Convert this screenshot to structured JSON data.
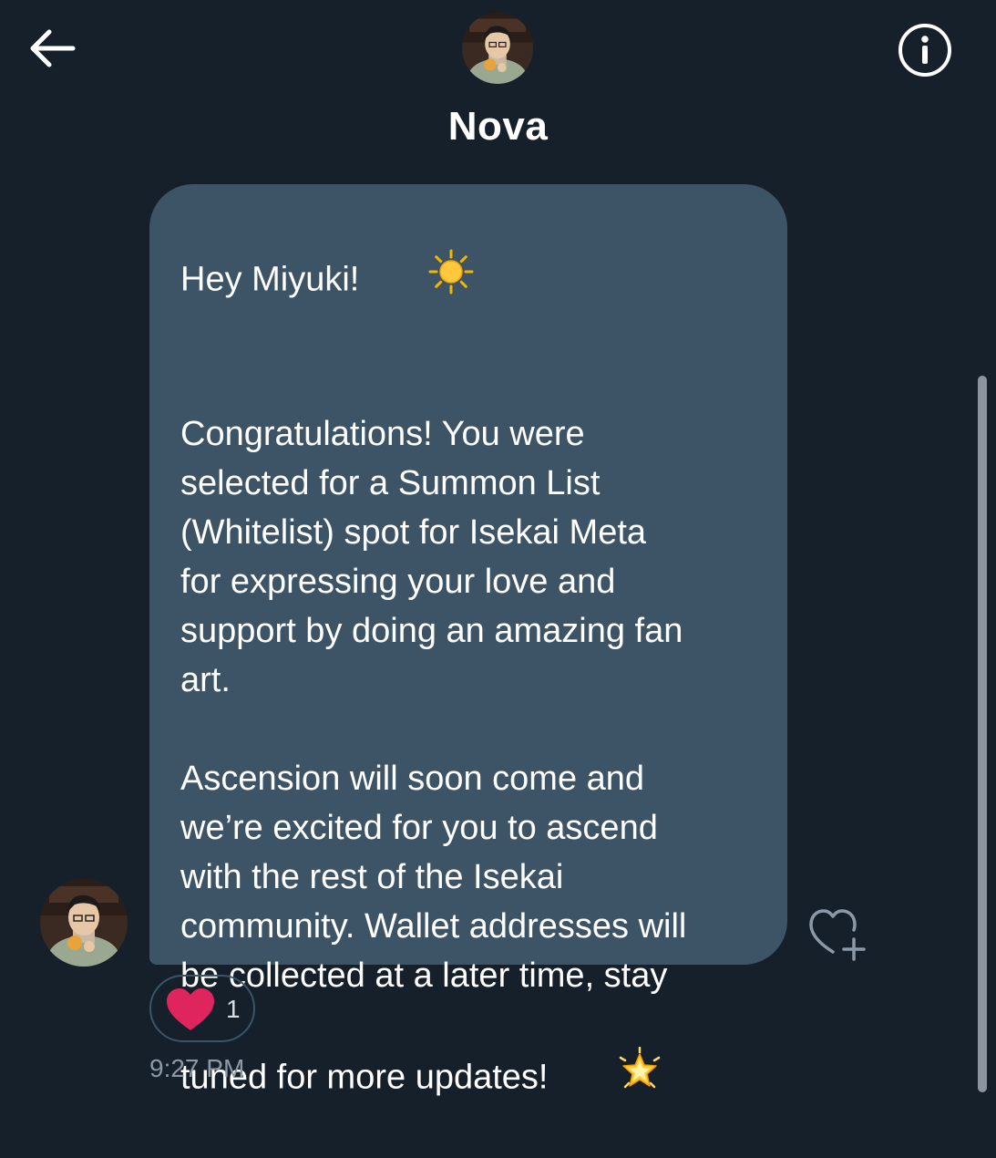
{
  "header": {
    "title": "Nova",
    "back_icon": "arrow-left-icon",
    "info_icon": "info-circle-icon"
  },
  "message": {
    "greeting": "Hey Miyuki!",
    "greeting_emoji": "sun-emoji",
    "paragraph_1_lines": [
      "Congratulations! You were",
      "selected for a Summon List",
      "(Whitelist) spot for Isekai Meta",
      "for expressing your love and",
      "support by doing an amazing fan",
      "art."
    ],
    "paragraph_2_lines": [
      "Ascension will soon come and",
      "we’re excited for you to ascend",
      "with the rest of the Isekai",
      "community. Wallet addresses will",
      "be collected at a later time, stay",
      "tuned for more updates!"
    ],
    "closing_emoji": "glowing-star-emoji",
    "reaction": {
      "icon": "heart-icon",
      "count": "1"
    },
    "timestamp": "9:27 PM"
  },
  "colors": {
    "background": "#15202b",
    "bubble": "#3d5466",
    "heart": "#e0245e",
    "timestamp": "#8b98a5"
  }
}
